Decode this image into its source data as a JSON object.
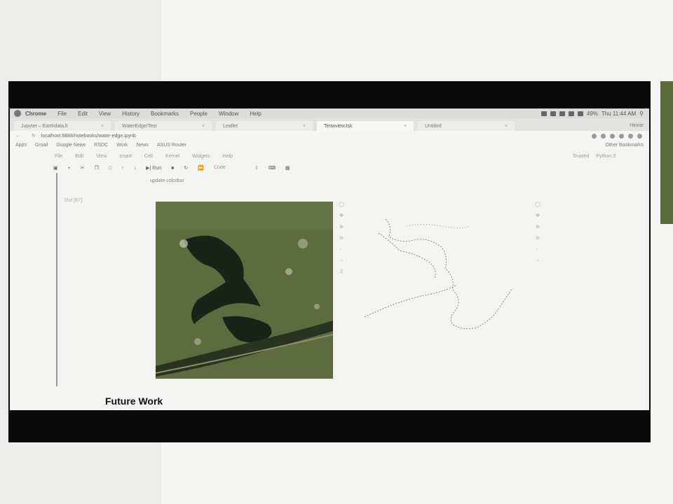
{
  "menubar": {
    "items": [
      "Chrome",
      "File",
      "Edit",
      "View",
      "History",
      "Bookmarks",
      "People",
      "Window",
      "Help"
    ],
    "battery": "49%",
    "clock": "Thu 11:44 AM"
  },
  "browser": {
    "tabs": [
      {
        "title": "Jupyter – Earthdata.lt"
      },
      {
        "title": "WaterEdge/Test"
      },
      {
        "title": "Leaflet"
      },
      {
        "title": "Terraview.tsk"
      },
      {
        "title": "Untitled"
      }
    ],
    "user": "Hinnie",
    "url": "localhost:8888/notebooks/water-edge.ipynb",
    "bookmarks": [
      "Apps",
      "Gmail",
      "Google News",
      "RSDC",
      "Work",
      "News",
      "ASUS Router"
    ],
    "other_bookmarks": "Other Bookmarks"
  },
  "notebook": {
    "menu": [
      "File",
      "Edit",
      "View",
      "Insert",
      "Cell",
      "Kernel",
      "Widgets",
      "Help"
    ],
    "status": "Trusted",
    "kernel": "Python 3",
    "toolbar": {
      "run_label": "Run",
      "cell_type": "Code"
    },
    "cell_tail_text": "update colorbar",
    "out_prompt": "Out [87]:"
  },
  "slide": {
    "heading": "Future Work"
  },
  "colors": {
    "map_land": "#5d6b3e",
    "map_water": "#1b2318",
    "outline": "#8a8a8a",
    "projector_band": "#0a0a0a"
  },
  "icons": {
    "map_tools": [
      "home-icon",
      "pan-icon",
      "zoom-in-icon",
      "zoom-out-icon",
      "back-icon",
      "forward-icon",
      "save-icon"
    ]
  }
}
